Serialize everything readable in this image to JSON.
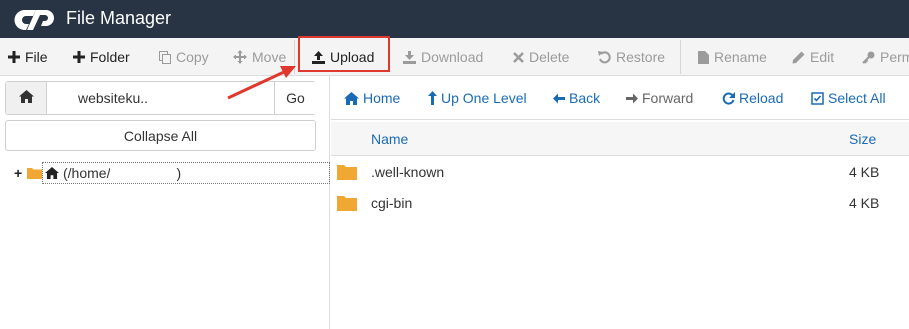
{
  "header": {
    "title": "File Manager"
  },
  "toolbar": {
    "file": "File",
    "folder": "Folder",
    "copy": "Copy",
    "move": "Move",
    "upload": "Upload",
    "download": "Download",
    "delete": "Delete",
    "restore": "Restore",
    "rename": "Rename",
    "edit": "Edit",
    "permissions": "Perm"
  },
  "address": {
    "value": "websiteku..",
    "go_label": "Go"
  },
  "sidebar": {
    "collapse_label": "Collapse All",
    "root_prefix": "(/home/",
    "root_suffix": ")"
  },
  "nav": {
    "home": "Home",
    "up_one_level": "Up One Level",
    "back": "Back",
    "forward": "Forward",
    "reload": "Reload",
    "select_all": "Select All"
  },
  "file_list": {
    "columns": {
      "name": "Name",
      "size": "Size"
    },
    "rows": [
      {
        "name": ".well-known",
        "size": "4 KB"
      },
      {
        "name": "cgi-bin",
        "size": "4 KB"
      }
    ]
  },
  "colors": {
    "header_bg": "#283444",
    "link": "#1a6bb5",
    "highlight": "#e0382f",
    "folder": "#f0a734"
  }
}
